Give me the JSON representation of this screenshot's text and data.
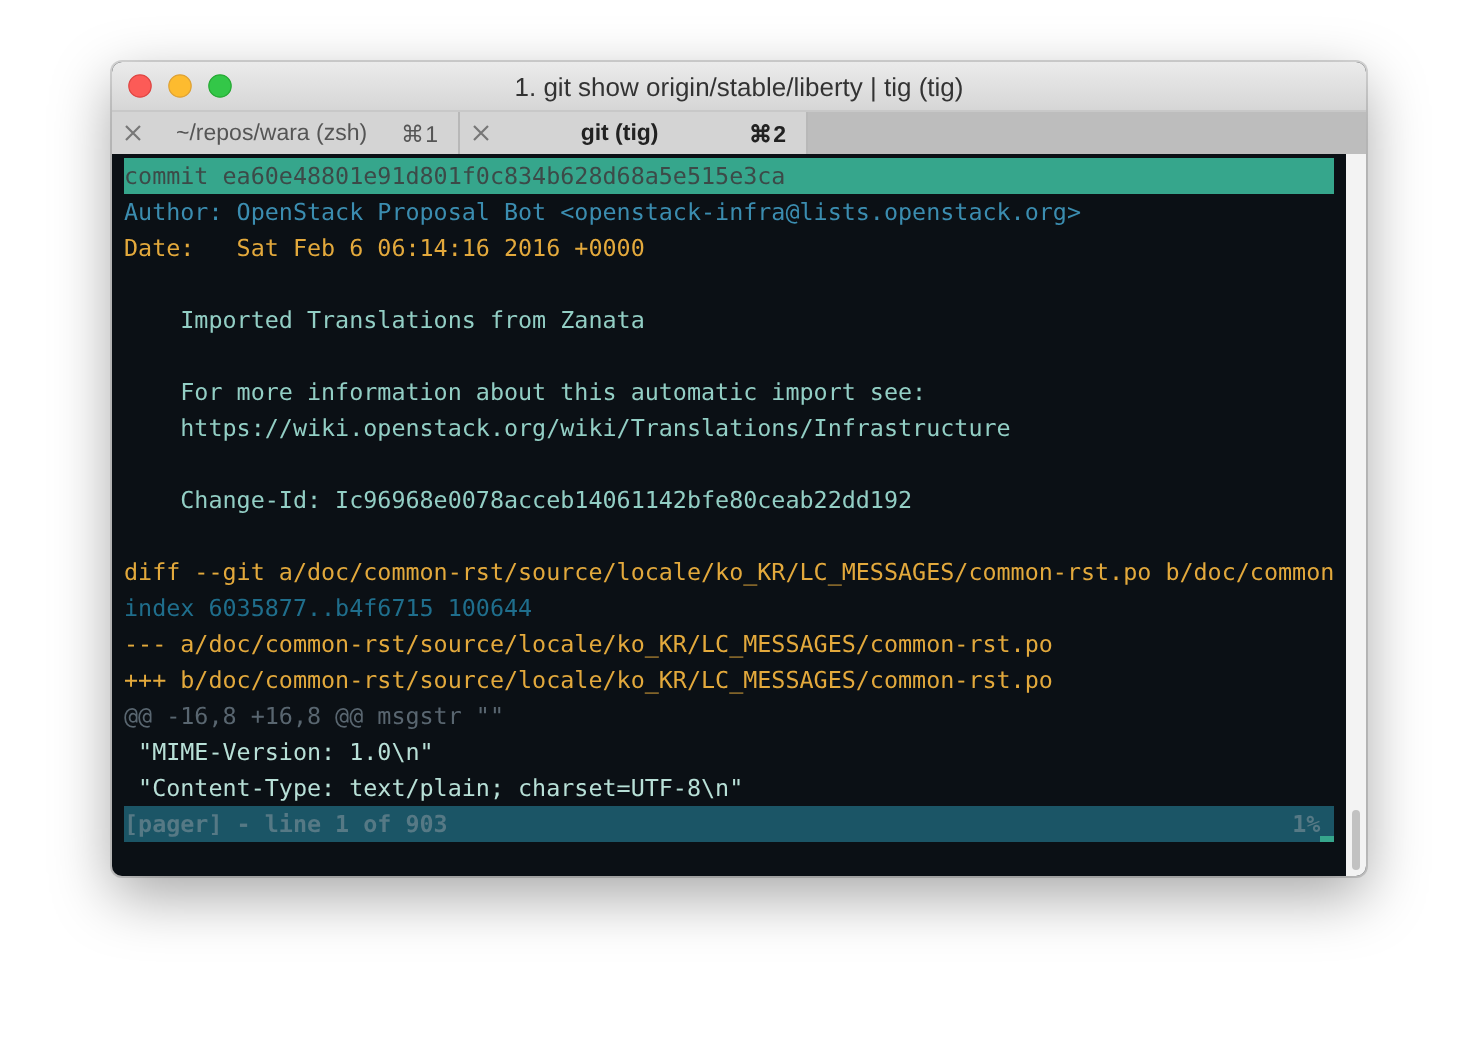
{
  "window": {
    "title": "1. git show origin/stable/liberty | tig (tig)"
  },
  "tabs": [
    {
      "label": "~/repos/wara (zsh)",
      "shortcut": "⌘1",
      "selected": false
    },
    {
      "label": "git (tig)",
      "shortcut": "⌘2",
      "selected": true
    }
  ],
  "lines": [
    {
      "kind": "commit",
      "text": "commit ea60e48801e91d801f0c834b628d68a5e515e3ca"
    },
    {
      "kind": "author",
      "text": "Author: OpenStack Proposal Bot <openstack-infra@lists.openstack.org>"
    },
    {
      "kind": "date",
      "text": "Date:   Sat Feb 6 06:14:16 2016 +0000"
    },
    {
      "kind": "blank"
    },
    {
      "kind": "body",
      "text": "    Imported Translations from Zanata"
    },
    {
      "kind": "blank"
    },
    {
      "kind": "body",
      "text": "    For more information about this automatic import see:"
    },
    {
      "kind": "body",
      "text": "    https://wiki.openstack.org/wiki/Translations/Infrastructure"
    },
    {
      "kind": "blank"
    },
    {
      "kind": "body",
      "text": "    Change-Id: Ic96968e0078acceb14061142bfe80ceab22dd192"
    },
    {
      "kind": "blank"
    },
    {
      "kind": "diff",
      "text": "diff --git a/doc/common-rst/source/locale/ko_KR/LC_MESSAGES/common-rst.po b/doc/common"
    },
    {
      "kind": "index",
      "text": "index 6035877..b4f6715 100644"
    },
    {
      "kind": "minus",
      "text": "--- a/doc/common-rst/source/locale/ko_KR/LC_MESSAGES/common-rst.po"
    },
    {
      "kind": "plus",
      "text": "+++ b/doc/common-rst/source/locale/ko_KR/LC_MESSAGES/common-rst.po"
    },
    {
      "kind": "hunk",
      "text": "@@ -16,8 +16,8 @@ msgstr \"\""
    },
    {
      "kind": "context",
      "text": " \"MIME-Version: 1.0\\n\""
    },
    {
      "kind": "context",
      "text": " \"Content-Type: text/plain; charset=UTF-8\\n\""
    }
  ],
  "status_bar": {
    "text": "[pager] - line 1 of 903",
    "percent": "1%"
  }
}
